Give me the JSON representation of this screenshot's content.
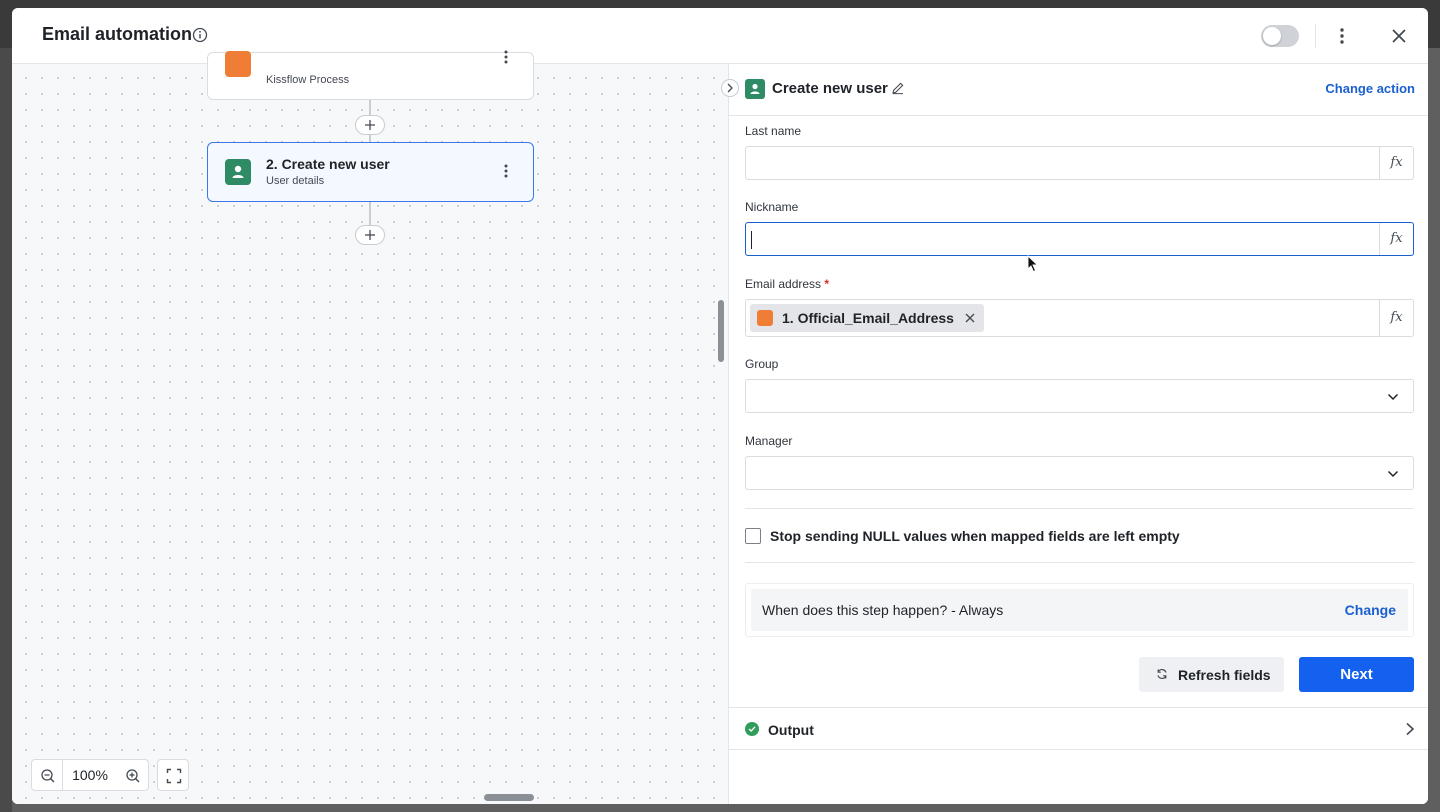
{
  "header": {
    "title": "Email automation"
  },
  "canvas": {
    "nodes": [
      {
        "title": "",
        "subtitle": "Kissflow Process"
      },
      {
        "title": "2. Create new user",
        "subtitle": "User details"
      }
    ],
    "zoom": "100%"
  },
  "panel": {
    "title": "Create new user",
    "change_action": "Change action",
    "fields": {
      "last_name": {
        "label": "Last name",
        "value": ""
      },
      "nickname": {
        "label": "Nickname",
        "value": ""
      },
      "email": {
        "label": "Email address",
        "required_mark": "*",
        "chip": "1. Official_Email_Address"
      },
      "group": {
        "label": "Group",
        "value": ""
      },
      "manager": {
        "label": "Manager",
        "value": ""
      }
    },
    "fx_label": "fx",
    "null_checkbox": {
      "label": "Stop sending NULL values when mapped fields are left empty",
      "checked": false
    },
    "when": {
      "text": "When does this step happen? - Always",
      "change": "Change"
    },
    "refresh_label": "Refresh fields",
    "next_label": "Next",
    "output_label": "Output"
  },
  "colors": {
    "accent": "#1461f0",
    "link": "#1a5fd0",
    "kissflow_orange": "#ef7d36",
    "user_green": "#2e8b63",
    "success": "#2e9e5a"
  }
}
